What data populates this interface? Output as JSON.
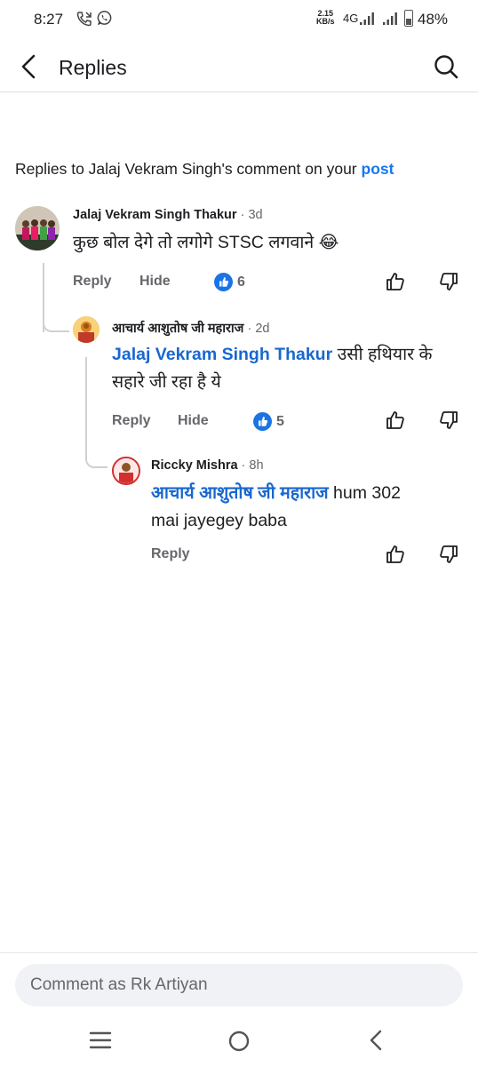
{
  "status_bar": {
    "time": "8:27",
    "speed_value": "2.15",
    "speed_unit": "KB/s",
    "network": "4G",
    "battery": "48%",
    "icons": [
      "call-forwarding-icon",
      "whatsapp-icon",
      "signal-icon",
      "signal-icon",
      "battery-icon"
    ]
  },
  "header": {
    "title": "Replies",
    "back_icon": "chevron-left-icon",
    "search_icon": "search-icon"
  },
  "heading": {
    "text": "Replies to Jalaj Vekram Singh's comment on your ",
    "link": "post"
  },
  "comments": [
    {
      "author": "Jalaj Vekram Singh Thakur",
      "time": " · 3d",
      "text": "कुछ बोल देगे तो लगोगे STSC लगवाने 😂",
      "reply_label": "Reply",
      "hide_label": "Hide",
      "likes": "6"
    },
    {
      "author": "आचार्य आशुतोष जी महाराज",
      "time": " · 2d",
      "mention": "Jalaj Vekram Singh Thakur",
      "text_line1": " उसी हथियार के",
      "text_line2": "सहारे जी रहा है ये",
      "reply_label": "Reply",
      "hide_label": "Hide",
      "likes": "5"
    },
    {
      "author": "Riccky Mishra",
      "time": " · 8h",
      "mention": "आचार्य आशुतोष जी महाराज",
      "text_line1": " hum 302",
      "text_line2": "mai jayegey  baba",
      "reply_label": "Reply"
    }
  ],
  "composer": {
    "placeholder": "Comment as Rk Artiyan"
  },
  "colors": {
    "accent": "#1877f2",
    "mention": "#1867d0",
    "secondary_text": "#65676b",
    "like_badge": "#1b74e4"
  }
}
